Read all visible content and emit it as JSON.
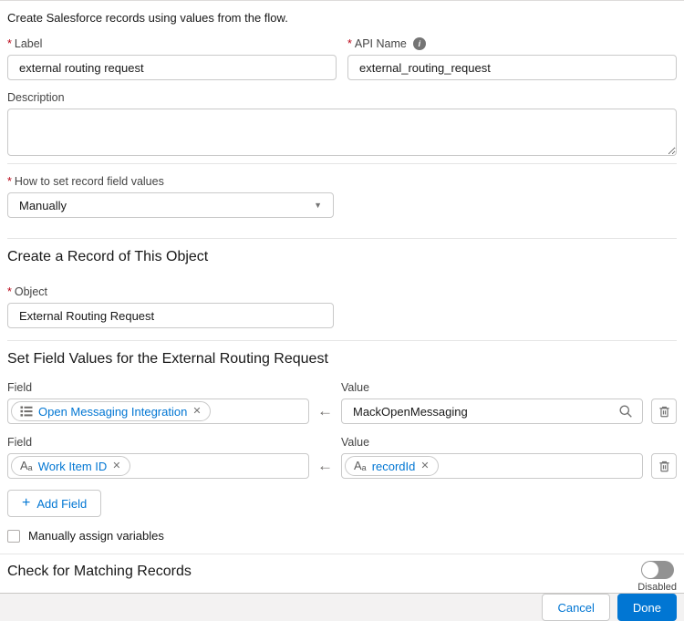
{
  "colors": {
    "brand_blue": "#0176d3",
    "required_red": "#ba0517",
    "border_gray": "#c9c9c9",
    "footer_bg": "#f3f2f2",
    "toggle_off_gray": "#929292"
  },
  "intro": "Create Salesforce records using values from the flow.",
  "form": {
    "label_field": {
      "label": "Label",
      "value": "external routing request",
      "required": true
    },
    "api_name_field": {
      "label": "API Name",
      "value": "external_routing_request",
      "required": true
    },
    "description_field": {
      "label": "Description",
      "value": ""
    },
    "how_to_set_field": {
      "label": "How to set record field values",
      "value": "Manually",
      "required": true
    },
    "object_field": {
      "label": "Object",
      "value": "External Routing Request",
      "required": true
    }
  },
  "sections": {
    "create_record_title": "Create a Record of This Object",
    "set_values_title": "Set Field Values for the External Routing Request",
    "matching_title": "Check for Matching Records"
  },
  "rows": [
    {
      "field_label": "Field",
      "field_pill": "Open Messaging Integration",
      "field_icon": "picklist-icon",
      "value_label": "Value",
      "value_text": "MackOpenMessaging"
    },
    {
      "field_label": "Field",
      "field_pill": "Work Item ID",
      "field_icon": "text-type-icon",
      "value_label": "Value",
      "value_pill": "recordId",
      "value_icon": "text-type-icon"
    }
  ],
  "add_field_button": "Add Field",
  "checkbox": {
    "label": "Manually assign variables",
    "checked": false
  },
  "toggle": {
    "state": "Disabled",
    "on": false
  },
  "footer": {
    "cancel": "Cancel",
    "done": "Done"
  },
  "glyphs": {
    "required": "*",
    "info": "i",
    "caret": "▼",
    "arrow": "←",
    "close": "✕",
    "plus": "+",
    "text_big": "A",
    "text_small": "a"
  }
}
